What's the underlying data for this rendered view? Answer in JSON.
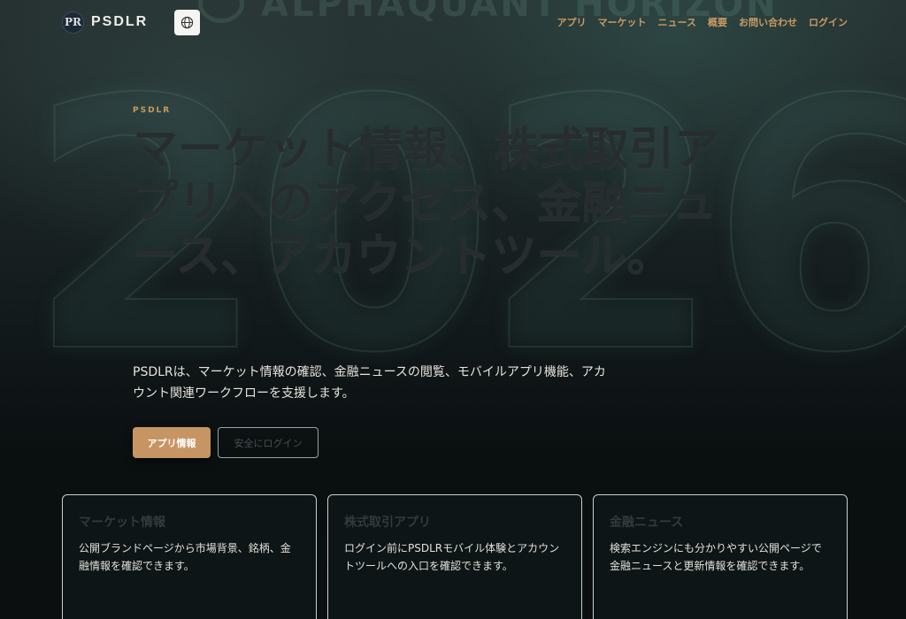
{
  "brand": {
    "logo_text": "PR",
    "name": "PSDLR"
  },
  "background": {
    "word": "ALPHAQUANT HORIZON",
    "year": "2026"
  },
  "nav": [
    "アプリ",
    "マーケット",
    "ニュース",
    "概要",
    "お問い合わせ",
    "ログイン"
  ],
  "hero": {
    "eyebrow": "PSDLR",
    "title": "マーケット情報、株式取引アプリへのアクセス、金融ニュース、アカウントツール。",
    "description": "PSDLRは、マーケット情報の確認、金融ニュースの閲覧、モバイルアプリ機能、アカウント関連ワークフローを支援します。",
    "primary_button": "アプリ情報",
    "secondary_button": "安全にログイン"
  },
  "cards": [
    {
      "title": "マーケット情報",
      "body": "公開ブランドページから市場背景、銘柄、金融情報を確認できます。"
    },
    {
      "title": "株式取引アプリ",
      "body": "ログイン前にPSDLRモバイル体験とアカウントツールへの入口を確認できます。"
    },
    {
      "title": "金融ニュース",
      "body": "検索エンジンにも分かりやすい公開ページで金融ニュースと更新情報を確認できます。"
    }
  ],
  "colors": {
    "accent": "#c79563",
    "nav": "#c99a62",
    "background": "#0b1112"
  },
  "icons": {
    "language": "globe-icon"
  }
}
